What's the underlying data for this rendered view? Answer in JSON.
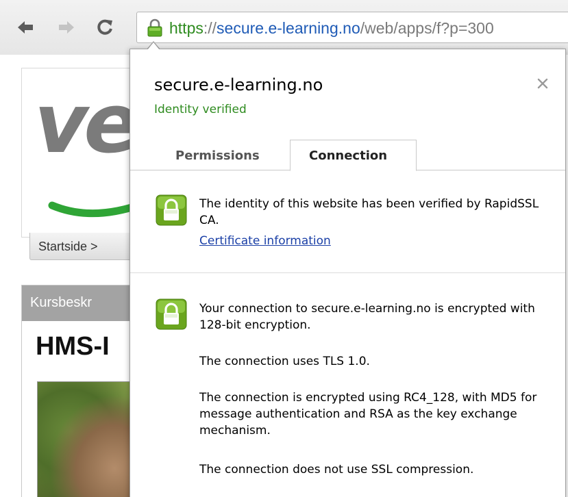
{
  "browser": {
    "url": {
      "scheme": "https",
      "separator": "://",
      "host": "secure.e-learning.no",
      "path": "/web/apps/f?p=300"
    }
  },
  "background_page": {
    "logo_text": "ve",
    "breadcrumb": "Startside >",
    "course_header": "Kursbeskr",
    "course_title": "HMS-I"
  },
  "security_bubble": {
    "site_name": "secure.e-learning.no",
    "identity_status": "Identity verified",
    "close_symbol": "×",
    "tabs": [
      {
        "label": "Permissions",
        "selected": false
      },
      {
        "label": "Connection",
        "selected": true
      }
    ],
    "identity_section": {
      "text": "The identity of this website has been verified by RapidSSL CA.",
      "link": "Certificate information"
    },
    "connection_section": {
      "paragraphs": [
        "Your connection to secure.e-learning.no is encrypted with 128-bit encryption.",
        "The connection uses TLS 1.0.",
        "The connection is encrypted using RC4_128, with MD5 for message authentication and RSA as the key exchange mechanism.",
        "The connection does not use SSL compression."
      ]
    }
  },
  "colors": {
    "verified_green": "#2e8b1f",
    "link_blue": "#1a3fa6",
    "host_blue": "#1f5bb6",
    "lock_green": "#6aa51e"
  },
  "icons": {
    "back": "back-arrow-icon",
    "forward": "forward-arrow-icon",
    "reload": "reload-icon",
    "address_lock": "padlock-icon",
    "close": "close-icon",
    "section_lock": "padlock-icon"
  }
}
